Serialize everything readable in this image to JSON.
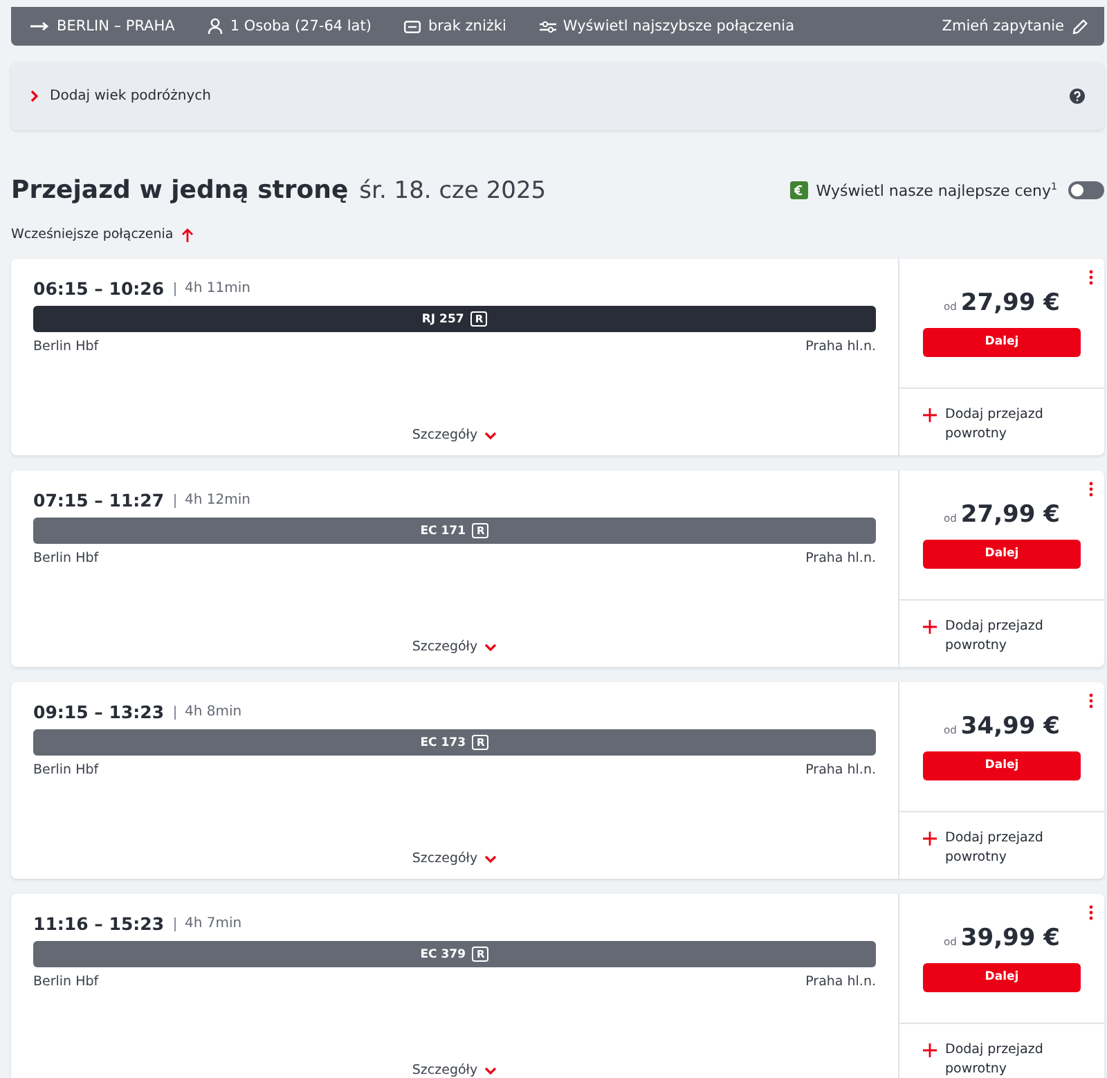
{
  "search_bar": {
    "route": "BERLIN – PRAHA",
    "passengers": "1 Osoba (27-64 lat)",
    "discount": "brak zniżki",
    "fastest": "Wyświetl najszybsze połączenia",
    "change": "Zmień zapytanie"
  },
  "age_panel": {
    "label": "Dodaj wiek podróżnych",
    "expanded": false
  },
  "heading": {
    "title": "Przejazd w jedną stronę",
    "date": "śr. 18. cze 2025",
    "best_prices": "Wyświetl nasze najlepsze ceny$^{1}$",
    "best_prices_on": false
  },
  "earlier": "Wcześniejsze połączenia",
  "connections": [
    {
      "times": "06:15 – 10:26",
      "duration": "4h 11min",
      "train": "RJ 257",
      "badge": "R",
      "selected": true,
      "from": "Berlin Hbf",
      "to": "Praha hl.n.",
      "details": "Szczegóły",
      "from_label": "od",
      "price": "27,99 €",
      "button": "Dalej",
      "return": "Dodaj przejazd powrotny"
    },
    {
      "times": "07:15 – 11:27",
      "duration": "4h 12min",
      "train": "EC 171",
      "badge": "R",
      "selected": false,
      "from": "Berlin Hbf",
      "to": "Praha hl.n.",
      "details": "Szczegóły",
      "from_label": "od",
      "price": "27,99 €",
      "button": "Dalej",
      "return": "Dodaj przejazd powrotny"
    },
    {
      "times": "09:15 – 13:23",
      "duration": "4h 8min",
      "train": "EC 173",
      "badge": "R",
      "selected": false,
      "from": "Berlin Hbf",
      "to": "Praha hl.n.",
      "details": "Szczegóły",
      "from_label": "od",
      "price": "34,99 €",
      "button": "Dalej",
      "return": "Dodaj przejazd powrotny"
    },
    {
      "times": "11:16 – 15:23",
      "duration": "4h 7min",
      "train": "EC 379",
      "badge": "R",
      "selected": false,
      "from": "Berlin Hbf",
      "to": "Praha hl.n.",
      "details": "Szczegóły",
      "from_label": "od",
      "price": "39,99 €",
      "button": "Dalej",
      "return": "Dodaj przejazd powrotny"
    }
  ]
}
